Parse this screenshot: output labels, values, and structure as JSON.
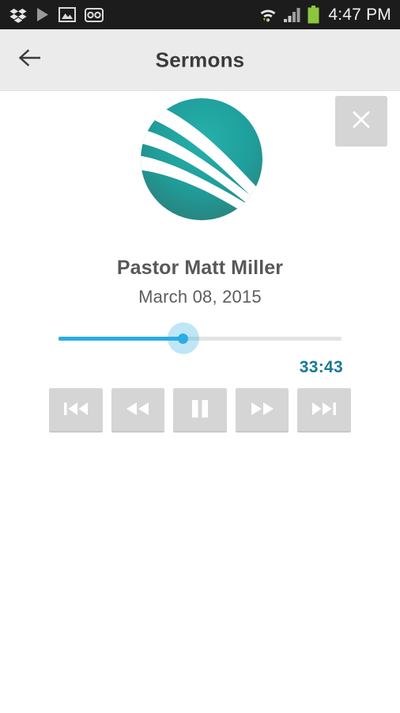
{
  "status_bar": {
    "background": "#1c1c1c",
    "clock": "4:47 PM",
    "left_icons": [
      {
        "name": "dropbox-icon",
        "label": "Dropbox"
      },
      {
        "name": "play-icon",
        "label": "Media playing"
      },
      {
        "name": "gallery-image-icon",
        "label": "Screenshot captured"
      },
      {
        "name": "voicemail-icon",
        "label": "Voicemail"
      }
    ],
    "right_icons": [
      {
        "name": "wifi-icon",
        "label": "Wi-Fi connected"
      },
      {
        "name": "cellular-signal-icon",
        "label": "Cellular signal"
      },
      {
        "name": "battery-icon",
        "label": "Battery",
        "color": "#8cc63e"
      }
    ]
  },
  "action_bar": {
    "background": "#ebebeb",
    "title": "Sermons",
    "back_icon": "arrow-left-icon"
  },
  "player": {
    "close_icon": "close-x-icon",
    "logo": {
      "name": "church-globe-logo",
      "color_light": "#20a39e",
      "color_dark": "#2e7f77"
    },
    "title": "Pastor Matt Miller",
    "date": "March 08, 2015",
    "seek": {
      "progress_percent": 44,
      "fill_color": "#2bace2",
      "track_color": "#e3e3e3"
    },
    "duration": "33:43",
    "duration_color": "#157a96",
    "controls": [
      {
        "name": "previous-track-button",
        "label": "Previous"
      },
      {
        "name": "rewind-button",
        "label": "Rewind"
      },
      {
        "name": "pause-button",
        "label": "Pause"
      },
      {
        "name": "fast-forward-button",
        "label": "Fast forward"
      },
      {
        "name": "next-track-button",
        "label": "Next"
      }
    ]
  }
}
